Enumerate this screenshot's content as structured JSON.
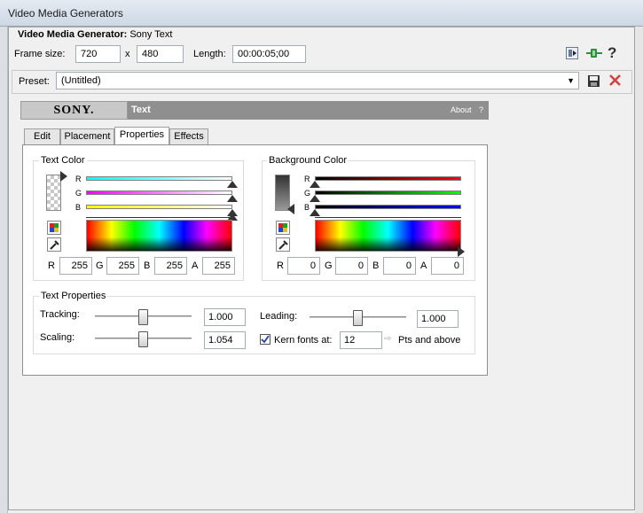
{
  "window": {
    "title": "Video Media Generators"
  },
  "generator": {
    "label": "Video Media Generator:",
    "name": "Sony Text"
  },
  "frame": {
    "size_label": "Frame size:",
    "width": "720",
    "x": "x",
    "height": "480",
    "length_label": "Length:",
    "length": "00:00:05;00"
  },
  "preset": {
    "label": "Preset:",
    "value": "(Untitled)"
  },
  "plugin": {
    "brand": "SONY.",
    "title": "Text",
    "about": "About",
    "help": "?"
  },
  "tabs": [
    {
      "label": "Edit"
    },
    {
      "label": "Placement"
    },
    {
      "label": "Properties"
    },
    {
      "label": "Effects"
    }
  ],
  "active_tab": "Properties",
  "text_color": {
    "group_label": "Text Color",
    "channels": [
      "R",
      "G",
      "B"
    ],
    "fields": [
      {
        "label": "R",
        "value": "255"
      },
      {
        "label": "G",
        "value": "255"
      },
      {
        "label": "B",
        "value": "255"
      },
      {
        "label": "A",
        "value": "255"
      }
    ],
    "slider_colors": [
      "#00ffff",
      "#ff00ff",
      "#ffff00"
    ]
  },
  "background_color": {
    "group_label": "Background Color",
    "channels": [
      "R",
      "G",
      "B"
    ],
    "fields": [
      {
        "label": "R",
        "value": "0"
      },
      {
        "label": "G",
        "value": "0"
      },
      {
        "label": "B",
        "value": "0"
      },
      {
        "label": "A",
        "value": "0"
      }
    ],
    "slider_colors": [
      "#ff0000",
      "#00ff00",
      "#0000ff"
    ]
  },
  "text_properties": {
    "group_label": "Text Properties",
    "tracking": {
      "label": "Tracking:",
      "value": "1.000",
      "level": 0.54
    },
    "scaling": {
      "label": "Scaling:",
      "value": "1.054",
      "level": 0.54
    },
    "leading": {
      "label": "Leading:",
      "value": "1.000",
      "level": 0.54
    },
    "kern": {
      "label": "Kern fonts at:",
      "value": "12",
      "checked": true,
      "suffix": "Pts and above"
    }
  },
  "toolbar": {
    "help": "?"
  },
  "colors": {
    "accent": "#2c8f39",
    "delete": "#d04040"
  }
}
